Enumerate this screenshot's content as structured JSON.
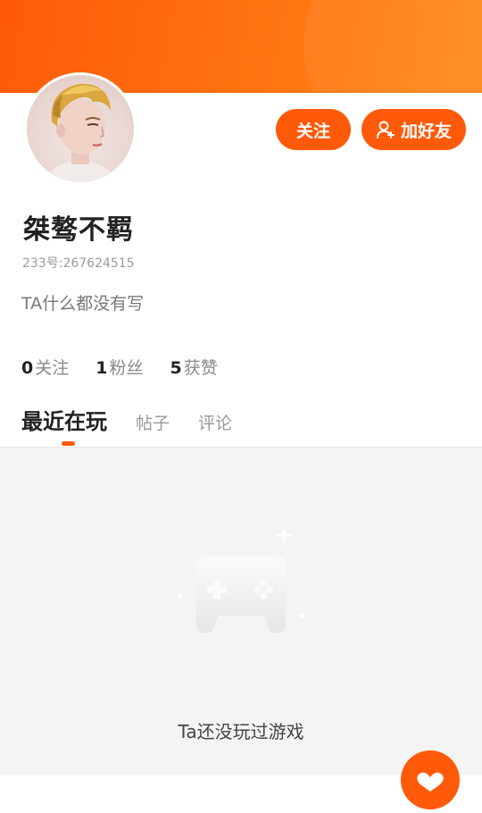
{
  "profile": {
    "name": "桀骜不羁",
    "uid": "233号:267624515",
    "bio": "TA什么都没有写"
  },
  "actions": {
    "follow_label": "关注",
    "add_friend_label": "加好友"
  },
  "stats": [
    {
      "value": "0",
      "label": "关注"
    },
    {
      "value": "1",
      "label": "粉丝"
    },
    {
      "value": "5",
      "label": "获赞"
    }
  ],
  "tabs": [
    {
      "label": "最近在玩",
      "active": true
    },
    {
      "label": "帖子",
      "active": false
    },
    {
      "label": "评论",
      "active": false
    }
  ],
  "empty_state": {
    "message": "Ta还没玩过游戏",
    "icon": "gamepad-icon"
  },
  "colors": {
    "accent": "#ff5a0a",
    "banner_end": "#ff8a1c",
    "content_bg": "#f4f4f4"
  }
}
